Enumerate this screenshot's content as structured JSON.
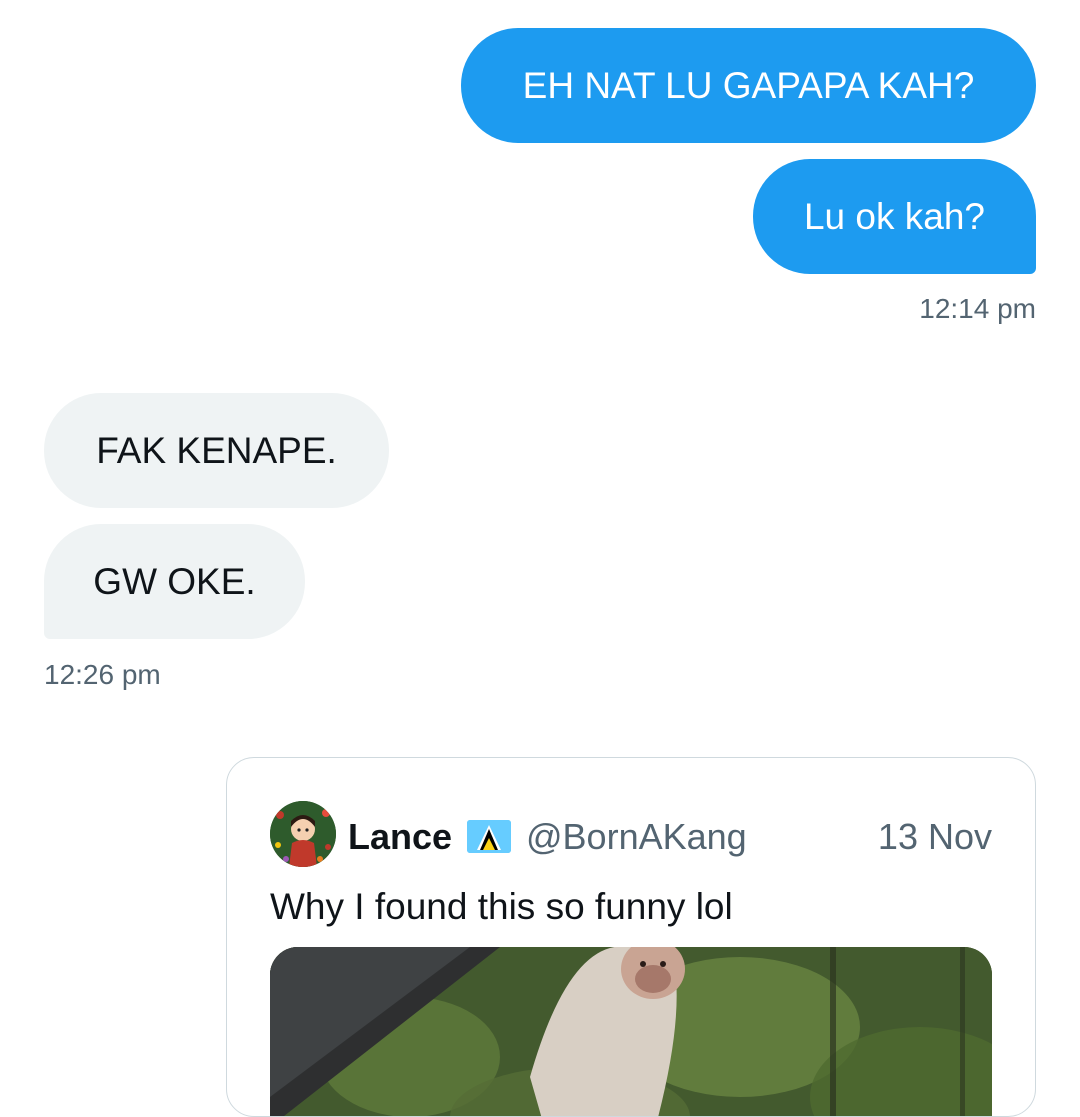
{
  "conversation": {
    "messages": [
      {
        "sender": "me",
        "text": "EH NAT LU GAPAPA KAH?"
      },
      {
        "sender": "me",
        "text": "Lu ok kah?"
      },
      {
        "sender": "them",
        "text": "FAK KENAPE."
      },
      {
        "sender": "them",
        "text": "GW OKE."
      }
    ],
    "timestamps": {
      "sent_group": "12:14 pm",
      "received_group": "12:26 pm"
    }
  },
  "shared_tweet": {
    "display_name": "Lance",
    "flag_icon": "saint-lucia-flag-icon",
    "handle": "@BornAKang",
    "date": "13 Nov",
    "text": "Why I found this so funny lol",
    "media": "video-thumbnail-monkey-in-forest"
  },
  "colors": {
    "sent_bubble": "#1d9bf0",
    "received_bubble": "#eff3f4",
    "secondary_text": "#536471",
    "primary_text": "#0f1419"
  }
}
